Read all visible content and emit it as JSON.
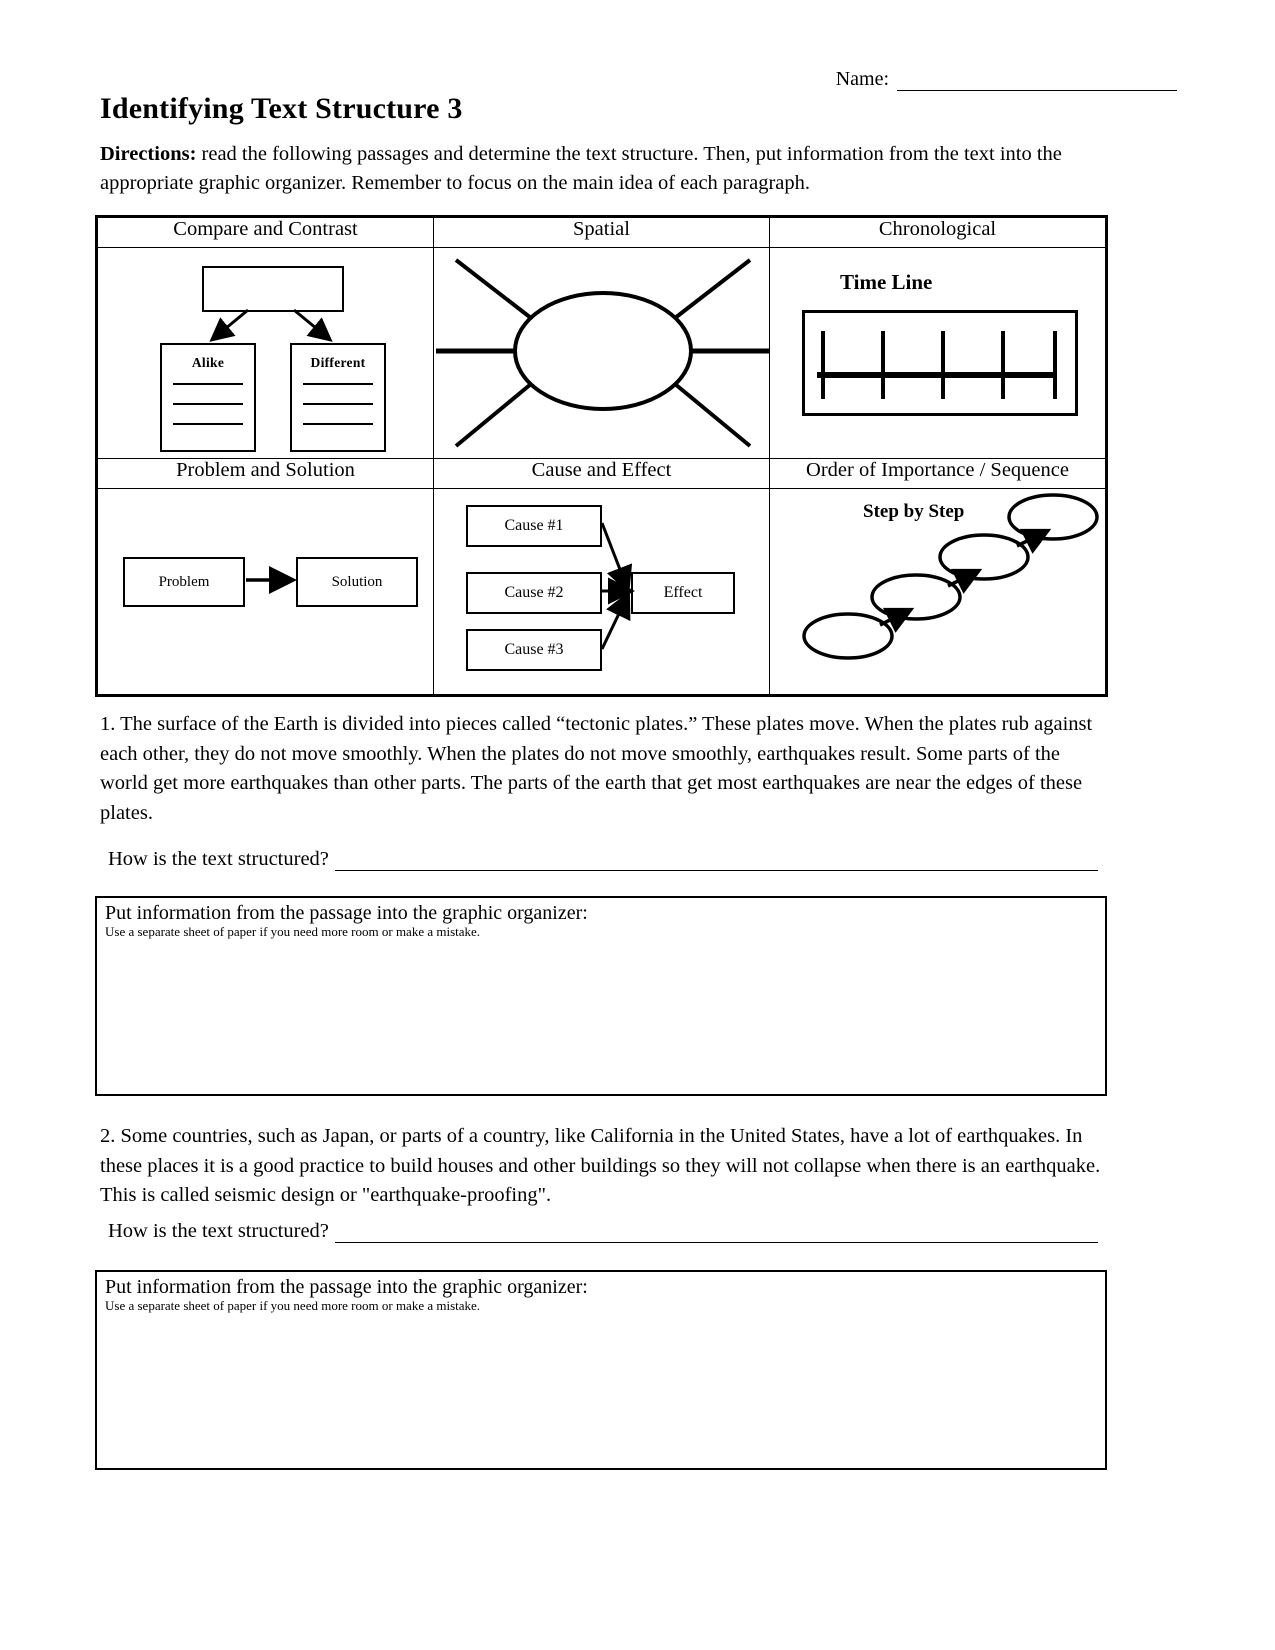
{
  "header": {
    "name_label": "Name:",
    "title": "Identifying Text Structure 3",
    "directions_bold": "Directions:",
    "directions_text": " read the following passages and determine the text structure. Then, put information from the text into the appropriate graphic organizer.  Remember to focus on the main idea of each paragraph."
  },
  "organizer": {
    "headers_row1": [
      "Compare and Contrast",
      "Spatial",
      "Chronological"
    ],
    "headers_row2": [
      "Problem and Solution",
      "Cause and Effect",
      "Order of Importance / Sequence"
    ],
    "compare_contrast": {
      "alike_label": "Alike",
      "different_label": "Different"
    },
    "chronological": {
      "timeline_title": "Time Line"
    },
    "problem_solution": {
      "problem_label": "Problem",
      "solution_label": "Solution"
    },
    "cause_effect": {
      "cause1_label": "Cause #1",
      "cause2_label": "Cause #2",
      "cause3_label": "Cause #3",
      "effect_label": "Effect"
    },
    "sequence": {
      "step_title": "Step by Step"
    }
  },
  "questions": [
    {
      "passage": "1. The surface of the Earth is divided into pieces called “tectonic plates.”  These plates move. When the plates rub against each other, they do not move smoothly. When the plates do not move smoothly, earthquakes result.  Some parts of the world get more earthquakes than other parts. The parts of the earth that get most earthquakes are near the edges of these plates.",
      "question_label": "How is the text structured?",
      "answer_box_title": "Put information from the passage into the graphic organizer:",
      "answer_box_note": "Use a separate sheet of paper if you need more room or make a mistake."
    },
    {
      "passage": "2. Some countries, such as Japan, or parts of a country, like California in the United States, have a lot of earthquakes. In these places it is a good practice to build houses and other buildings so they will not collapse when there is an earthquake. This is called seismic design or \"earthquake-proofing\".",
      "question_label": "How is the text structured?",
      "answer_box_title": "Put information from the passage into the graphic organizer:",
      "answer_box_note": "Use a separate sheet of paper if you need more room or make a mistake."
    }
  ],
  "colors": {
    "ink": "#000000",
    "paper": "#ffffff"
  }
}
